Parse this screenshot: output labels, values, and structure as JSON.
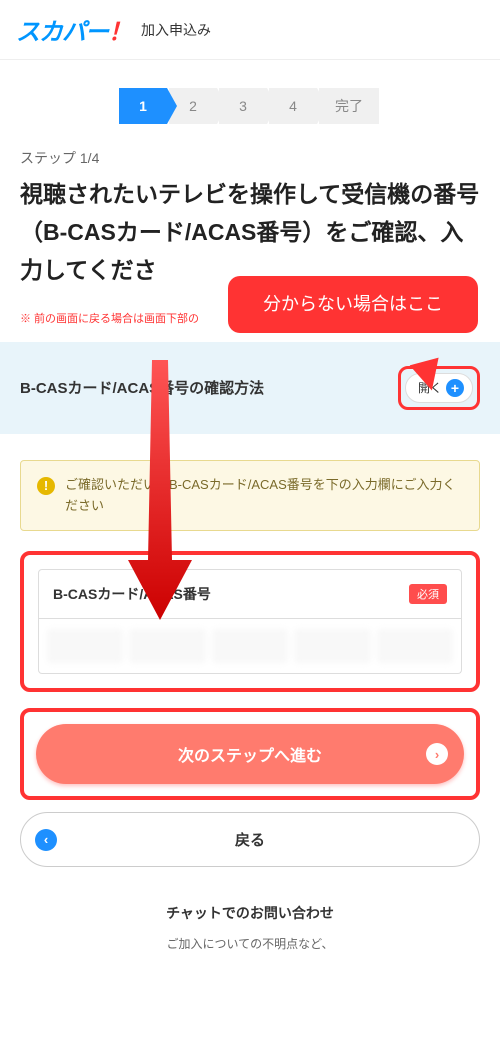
{
  "header": {
    "logo_main": "スカパー",
    "logo_exclaim": "！",
    "title": "加入申込み"
  },
  "stepper": {
    "steps": [
      "1",
      "2",
      "3",
      "4",
      "完了"
    ],
    "active_index": 0
  },
  "step_label": "ステップ 1/4",
  "main_heading": "視聴されたいテレビを操作して受信機の番号（B-CASカード/ACAS番号）をご確認、入力してくださ",
  "warning_note": "※ 前の画面に戻る場合は画面下部の",
  "callout_text": "分からない場合はここ",
  "expand": {
    "title": "B-CASカード/ACAS番号の確認方法",
    "button_label": "開く"
  },
  "info_banner": "ご確認いただいたB-CASカード/ACAS番号を下の入力欄にご入力ください",
  "input": {
    "label": "B-CASカード/ACAS番号",
    "required": "必須",
    "field_count": 5
  },
  "buttons": {
    "next": "次のステップへ進む",
    "back": "戻る"
  },
  "footer": {
    "title": "チャットでのお問い合わせ",
    "text": "ご加入についての不明点など、"
  }
}
